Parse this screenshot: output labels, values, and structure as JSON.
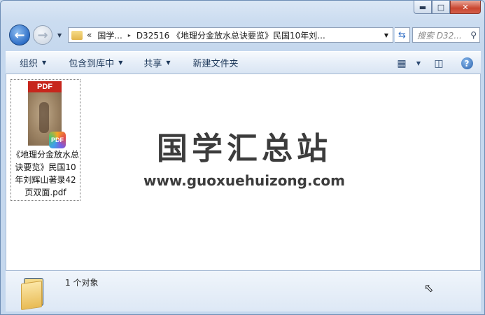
{
  "window": {
    "caption": {
      "minimize": "▬",
      "maximize": "□",
      "close": "✕"
    }
  },
  "nav": {
    "back_icon": "arrow-left-icon",
    "forward_icon": "arrow-right-icon",
    "address": {
      "overflow": "«",
      "segment1": "国学...",
      "separator": "▸",
      "segment2": "D32516 《地理分金放水总诀要览》民国10年刘..."
    },
    "search_placeholder": "搜索 D32..."
  },
  "toolbar": {
    "organize": "组织",
    "include_library": "包含到库中",
    "share": "共享",
    "new_folder": "新建文件夹"
  },
  "content": {
    "file": {
      "thumb_label": "PDF",
      "badge_label": "PDF",
      "name": "《地理分金放水总诀要览》民国10年刘辉山著录42页双面.pdf"
    },
    "watermark": {
      "title": "国学汇总站",
      "url": "www.guoxuehuizong.com"
    }
  },
  "details": {
    "count": "1 个对象"
  },
  "colors": {
    "accent": "#2f6fc7",
    "close_red": "#c9452f",
    "pdf_red": "#c7261c"
  }
}
